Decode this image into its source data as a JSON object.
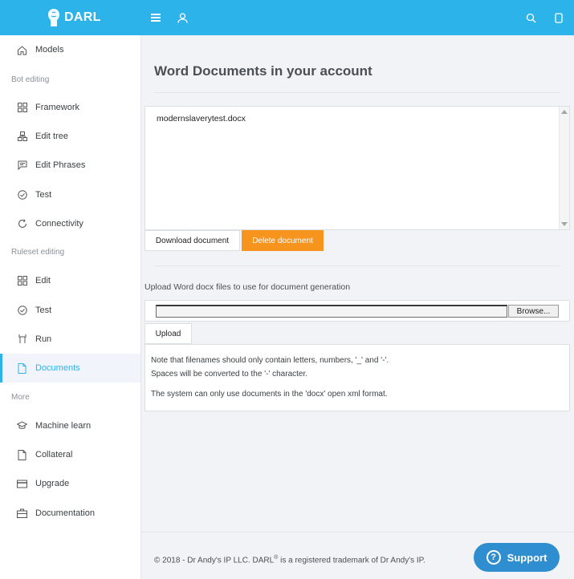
{
  "app": {
    "brand": "DARL"
  },
  "sidebar": {
    "sections": {
      "bot_editing": "Bot editing",
      "ruleset_editing": "Ruleset editing",
      "more": "More"
    },
    "items": [
      {
        "label": "Models",
        "icon": "home-icon"
      },
      {
        "label": "Framework",
        "icon": "grid-icon"
      },
      {
        "label": "Edit tree",
        "icon": "tree-icon"
      },
      {
        "label": "Edit Phrases",
        "icon": "chat-icon"
      },
      {
        "label": "Test",
        "icon": "check-circle-icon"
      },
      {
        "label": "Connectivity",
        "icon": "refresh-icon"
      },
      {
        "label": "Edit",
        "icon": "grid-icon"
      },
      {
        "label": "Test",
        "icon": "check-circle-icon"
      },
      {
        "label": "Run",
        "icon": "run-icon"
      },
      {
        "label": "Documents",
        "icon": "document-icon",
        "active": true
      },
      {
        "label": "Machine learn",
        "icon": "graduation-cap-icon"
      },
      {
        "label": "Collateral",
        "icon": "document-icon"
      },
      {
        "label": "Upgrade",
        "icon": "card-icon"
      },
      {
        "label": "Documentation",
        "icon": "briefcase-icon"
      }
    ]
  },
  "main": {
    "title": "Word Documents in your account",
    "documents": [
      "modernslaverytest.docx"
    ],
    "download_label": "Download document",
    "delete_label": "Delete document",
    "upload_label": "Upload Word docx files to use for document generation",
    "browse_label": "Browse...",
    "upload_button": "Upload",
    "notes": [
      "Note that filenames should only contain letters, numbers, '_' and '-'.",
      "Spaces will be converted to the '-' character.",
      "The system can only use documents in the 'docx' open xml format."
    ]
  },
  "footer": {
    "prefix": "© 2018 - Dr Andy's IP LLC. DARL",
    "sup": "®",
    "suffix": " is a registered trademark of Dr Andy's IP."
  },
  "support": {
    "label": "Support",
    "icon": "help-icon"
  },
  "colors": {
    "topbar": "#2bb3ea",
    "accent": "#2bb3ea",
    "delete": "#f7941d",
    "support": "#2f8ed0"
  }
}
